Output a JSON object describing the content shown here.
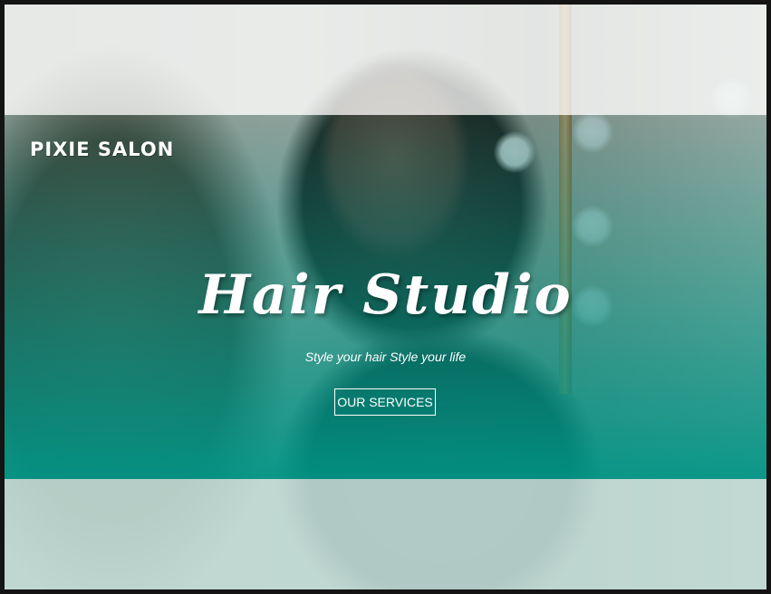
{
  "header": {
    "brand": "PIXIE SALON"
  },
  "hero": {
    "title": "Hair Studio",
    "tagline": "Style your hair Style your life",
    "cta_label": "OUR SERVICES"
  },
  "colors": {
    "accent": "#009485",
    "page_border": "#141414",
    "text": "#ffffff"
  }
}
